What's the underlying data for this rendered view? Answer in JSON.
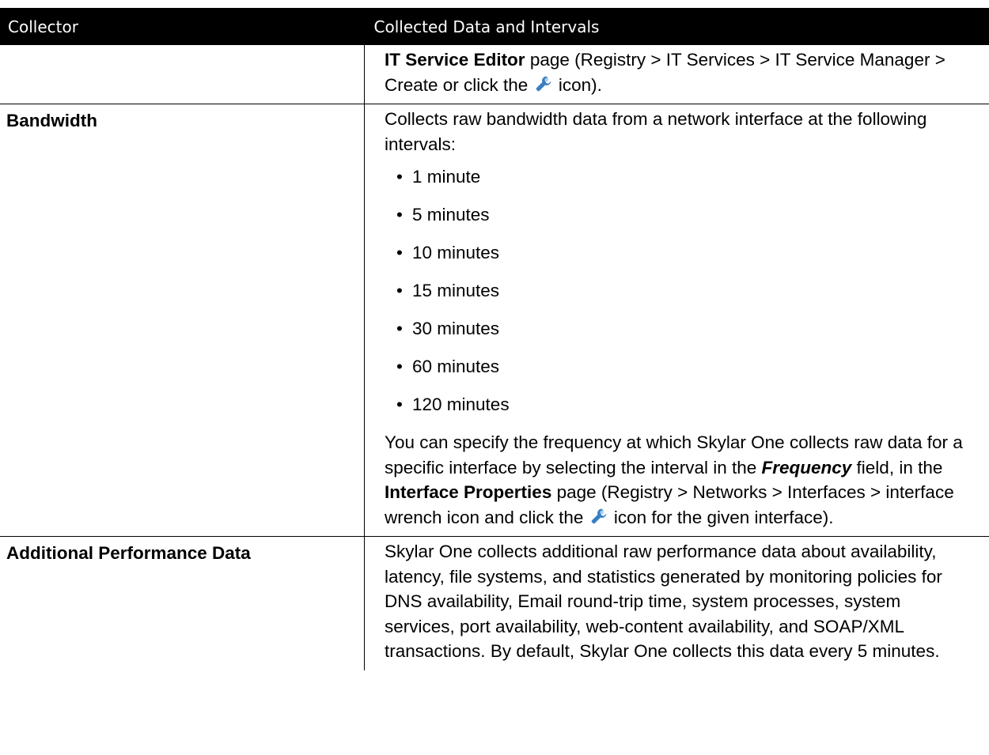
{
  "header": {
    "col_collector": "Collector",
    "col_data": "Collected Data and Intervals"
  },
  "row_continued": {
    "bold_lead": "IT Service Editor",
    "text_1": " page (Registry > IT Services > IT Service Manager > Create or click the ",
    "text_2": " icon)."
  },
  "row_bandwidth": {
    "collector": "Bandwidth",
    "intro": "Collects raw bandwidth data from a network interface at the following intervals:",
    "intervals": [
      " 1 minute",
      "5 minutes",
      "10 minutes",
      "15 minutes",
      "30 minutes",
      "60 minutes",
      "120 minutes"
    ],
    "bullet": "•",
    "para_1": "You can specify the frequency at which Skylar One collects raw data for a specific interface by selecting the interval in the ",
    "field_name": "Frequency",
    "para_2": " field, in the ",
    "page_name": "Interface Properties",
    "para_3": " page (Registry > Networks > Interfaces > interface wrench icon and click the ",
    "para_4": " icon for the given interface)."
  },
  "row_additional": {
    "collector": "Additional Performance Data",
    "text": "Skylar One collects additional raw performance data about availability, latency, file systems, and statistics generated by monitoring policies for DNS availability, Email round-trip time, system processes, system services, port availability, web-content availability, and SOAP/XML transactions. By default, Skylar One collects this data every 5 minutes."
  },
  "icons": {
    "wrench": "wrench-icon",
    "wrench_color": "#3a7fc4"
  }
}
